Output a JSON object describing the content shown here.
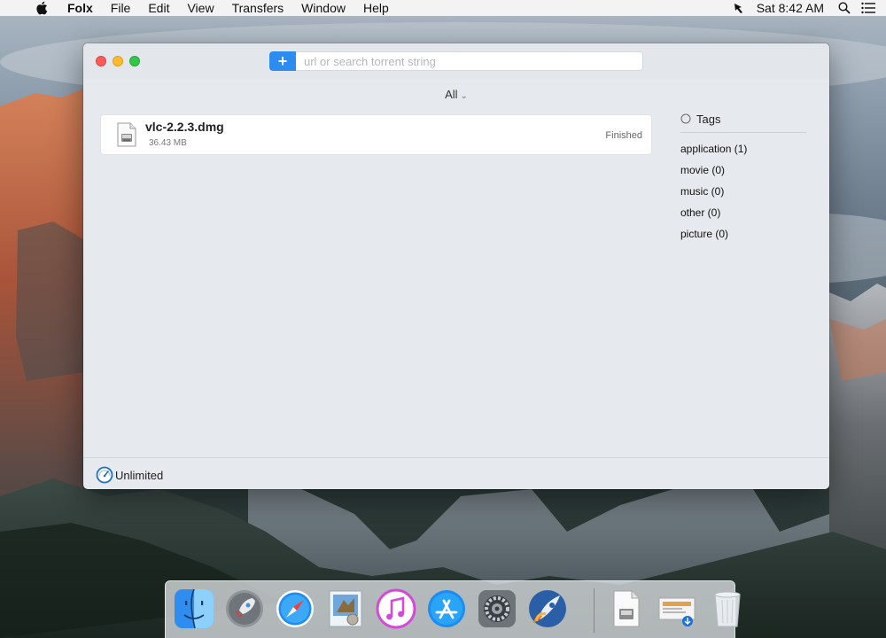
{
  "menubar": {
    "app_name": "Folx",
    "items": [
      "File",
      "Edit",
      "View",
      "Transfers",
      "Window",
      "Help"
    ],
    "clock": "Sat 8:42 AM",
    "status_icons": [
      "folx-status-icon",
      "spotlight-icon",
      "notification-center-icon"
    ]
  },
  "window": {
    "search": {
      "add_label": "+",
      "placeholder": "url or search torrent string"
    },
    "filter": {
      "label": "All",
      "chevron": "⌄"
    },
    "transfers": [
      {
        "name": "vlc-2.2.3.dmg",
        "size": "36.43 MB",
        "status": "Finished",
        "icon": "dmg-file-icon"
      }
    ],
    "tags": {
      "header": "Tags",
      "items": [
        "application (1)",
        "movie (0)",
        "music (0)",
        "other (0)",
        "picture (0)"
      ]
    },
    "footer": {
      "speed_limit": "Unlimited"
    }
  },
  "dock": {
    "apps": [
      "finder-icon",
      "launchpad-icon",
      "safari-icon",
      "mail-icon",
      "itunes-icon",
      "app-store-icon",
      "system-preferences-icon",
      "folx-icon"
    ],
    "right_items": [
      "documents-stack-icon",
      "downloads-stack-icon",
      "trash-icon"
    ]
  },
  "colors": {
    "accent_blue": "#2d8cf0",
    "close": "#fc5b57",
    "minimize": "#fdbc2f",
    "maximize": "#33c748"
  }
}
